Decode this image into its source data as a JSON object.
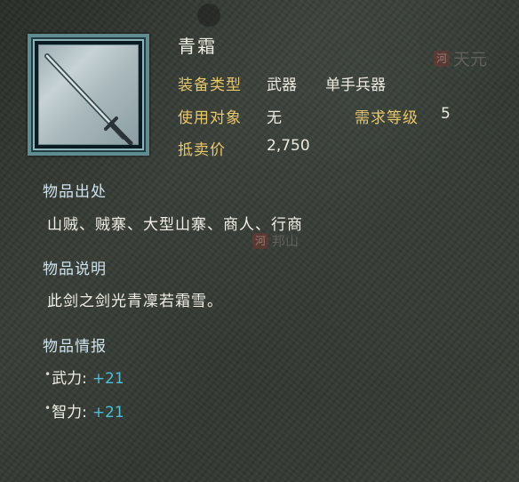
{
  "background_marks": {
    "map_label_1": "天元",
    "map_label_2": "邦山",
    "seal_char": "河"
  },
  "item": {
    "name": "青霜",
    "icon": "sword-icon"
  },
  "fields": {
    "equip_type_label": "装备类型",
    "equip_type_value": "武器",
    "equip_subtype_value": "单手兵器",
    "user_label": "使用对象",
    "user_value": "无",
    "req_level_label": "需求等级",
    "req_level_value": "5",
    "sell_label": "抵卖价",
    "sell_value": "2,750"
  },
  "sections": {
    "source_title": "物品出处",
    "source_text": "山贼、贼寨、大型山寨、商人、行商",
    "desc_title": "物品说明",
    "desc_text": "此剑之剑光青凜若霜雪。",
    "stats_title": "物品情报"
  },
  "stats": [
    {
      "label": "武力:",
      "bonus": "+21"
    },
    {
      "label": "智力:",
      "bonus": "+21"
    }
  ],
  "colors": {
    "label_gold": "#e8c66a",
    "section_blue": "#cfe3ee",
    "bonus_cyan": "#49c0d8",
    "frame_teal": "#5e8c90"
  }
}
